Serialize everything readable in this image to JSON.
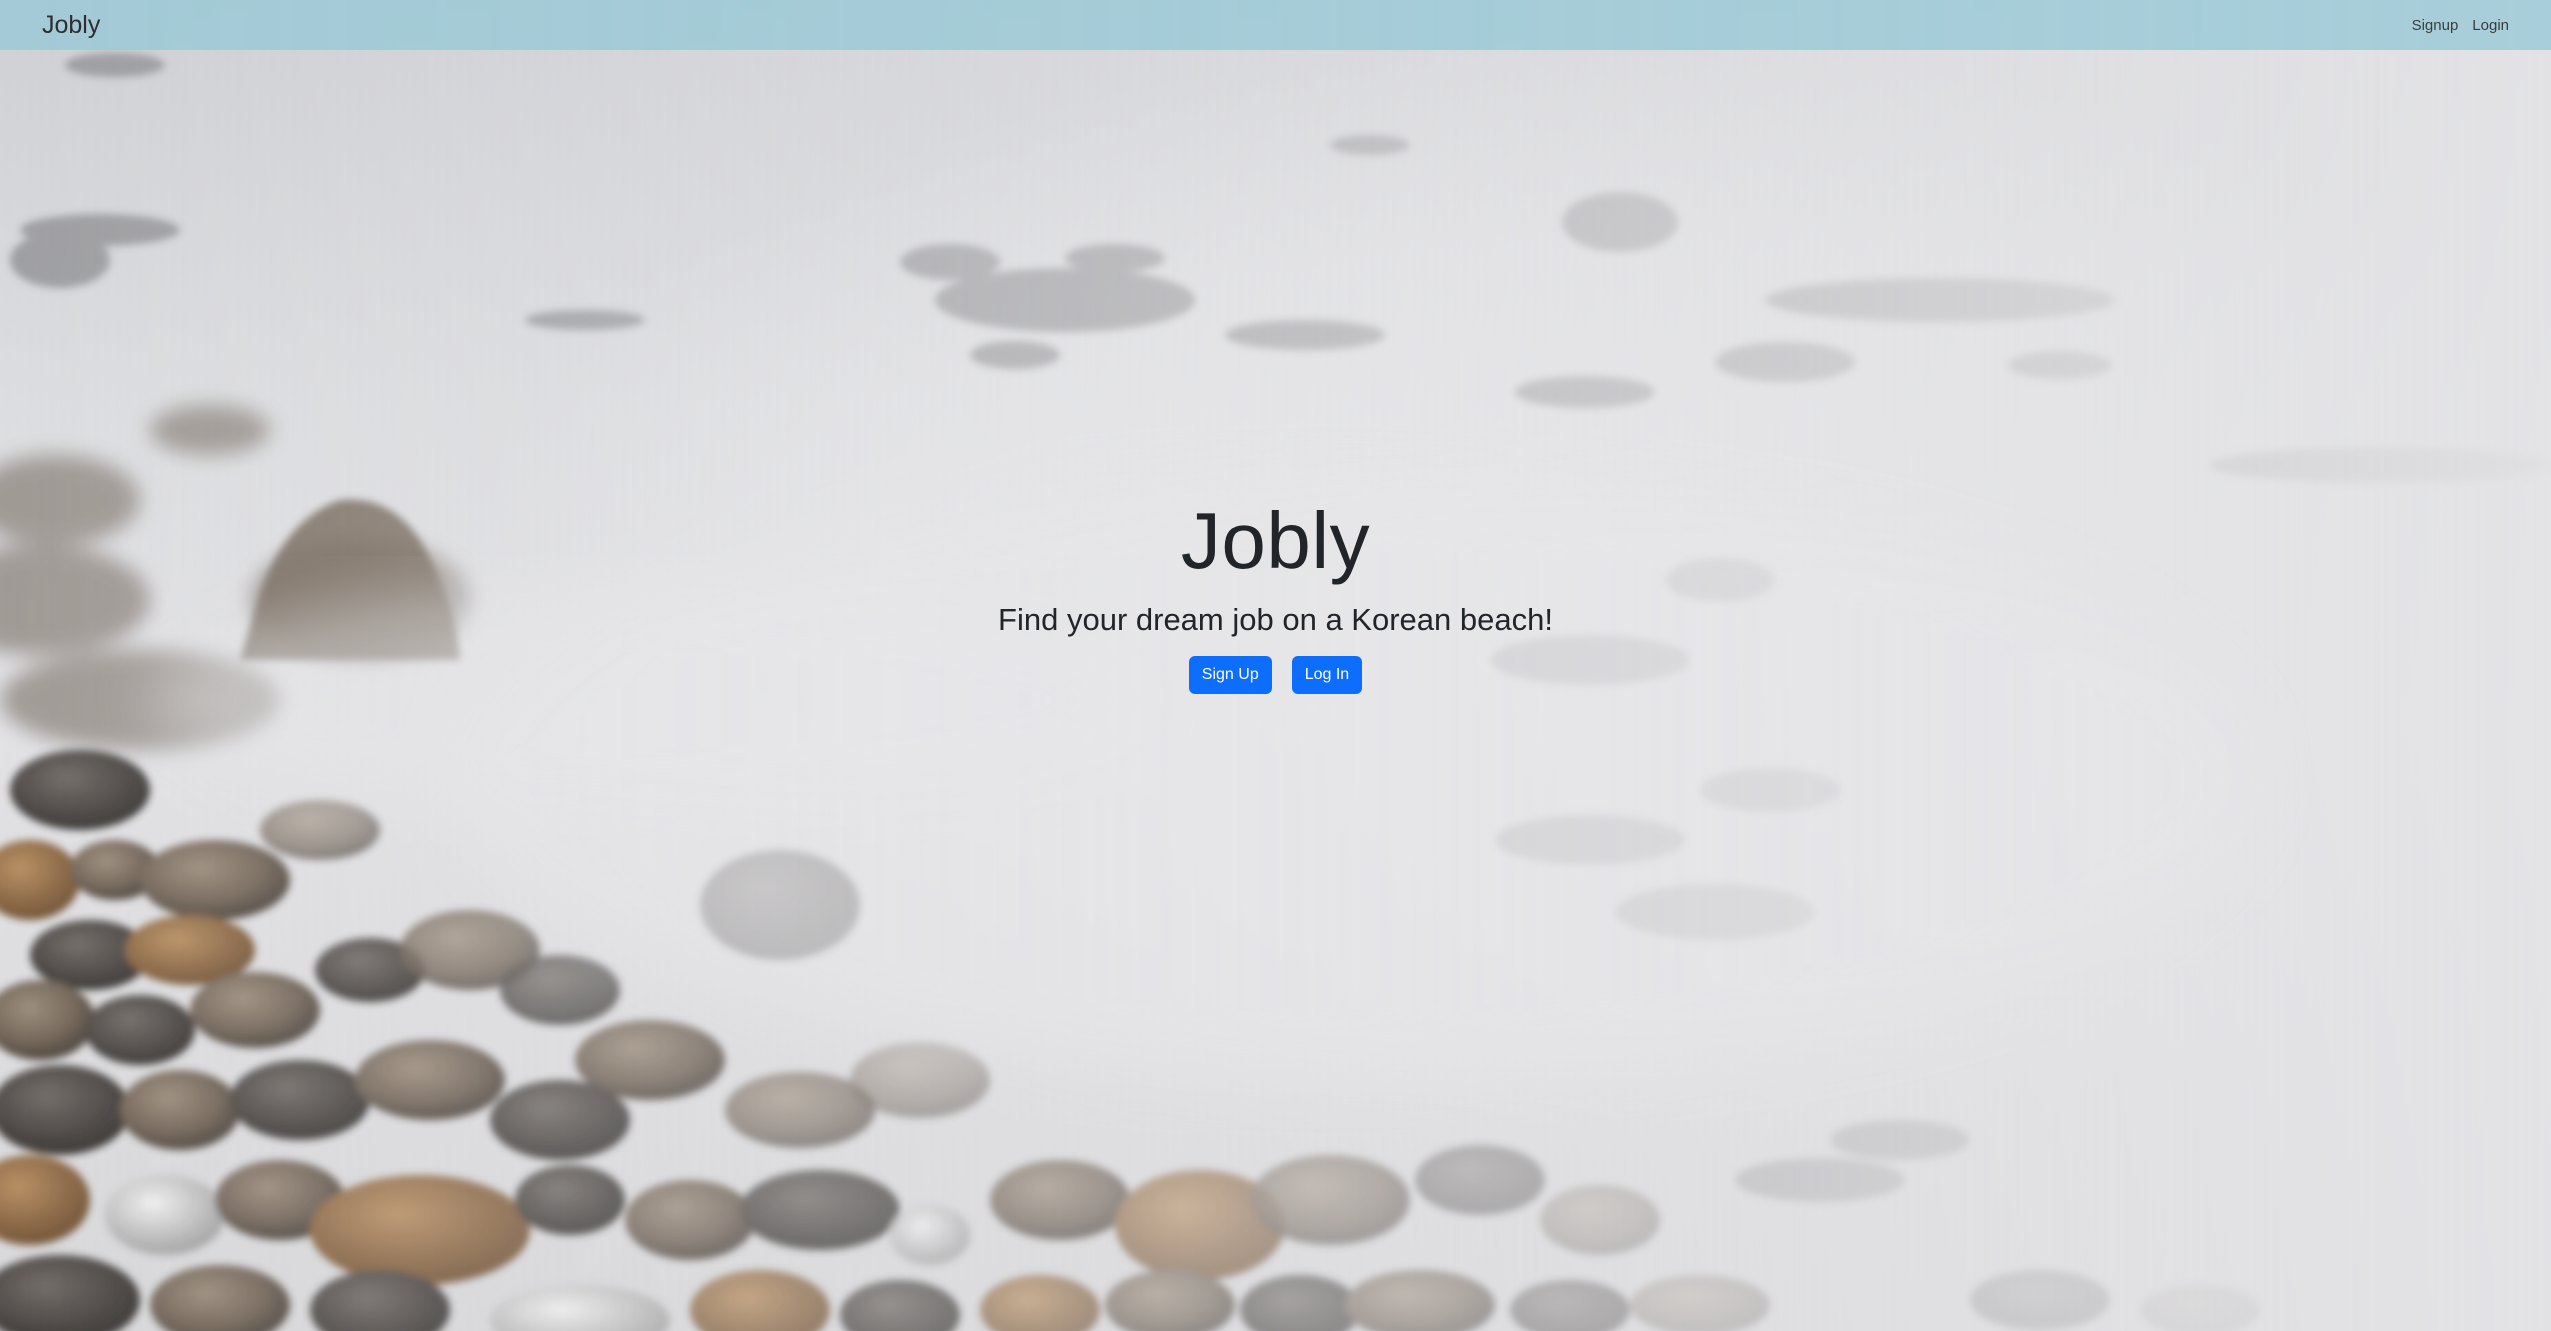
{
  "navbar": {
    "brand": "Jobly",
    "links": [
      {
        "label": "Signup"
      },
      {
        "label": "Login"
      }
    ],
    "background_color": "#96c8d6"
  },
  "hero": {
    "title": "Jobly",
    "tagline": "Find your dream job on a Korean beach!",
    "buttons": [
      {
        "label": "Sign Up",
        "color": "#0d6efd"
      },
      {
        "label": "Log In",
        "color": "#0d6efd"
      }
    ]
  }
}
